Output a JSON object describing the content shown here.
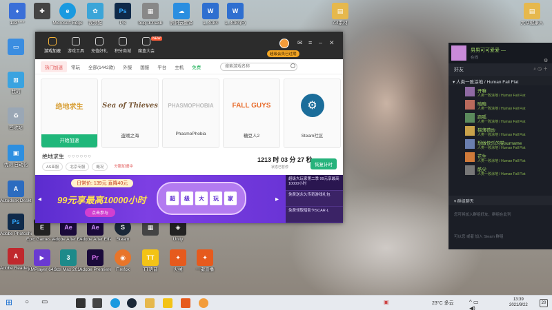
{
  "desktop": {
    "icons": [
      {
        "label": "133****",
        "color": "#3a6fd8"
      },
      {
        "label": "",
        "color": "#444"
      },
      {
        "label": "Microsoft Edge",
        "color": "#1a9ae0"
      },
      {
        "label": "视频配",
        "color": "#3ba5d8"
      },
      {
        "label": "PS",
        "color": "#0f2a4a"
      },
      {
        "label": "renren",
        "color": "#888"
      },
      {
        "label": "bug-d0f/a8b",
        "color": "#777"
      },
      {
        "label": "腾讯云翻译",
        "color": "#2b8ee0"
      },
      {
        "label": "1_4084",
        "color": "#2f6fd0"
      },
      {
        "label": "1_4084(F)",
        "color": "#2f6fd0"
      },
      {
        "label": "A4素材",
        "color": "#e6b84d"
      },
      {
        "label": "大众健康人",
        "color": "#e6b84d"
      }
    ],
    "left_icons": [
      {
        "label": "",
        "color": "#3b8de0"
      },
      {
        "label": "我的",
        "color": "#3aa3e0"
      },
      {
        "label": "回收站",
        "color": "#9aa7b5"
      },
      {
        "label": "优测 自动化",
        "color": "#2e8fe0"
      },
      {
        "label": "Autodesk Desktop",
        "color": "#2c6cc0"
      },
      {
        "label": "Adobe Photoshop",
        "color": "#0f2a4a"
      },
      {
        "label": "Adobe Reader XI",
        "color": "#c0282d"
      }
    ],
    "row_icons": [
      {
        "label": "Epic Games Launcher",
        "color": "#222"
      },
      {
        "label": "Adobe After Effects",
        "color": "#1a0a3a"
      },
      {
        "label": "Adobe After Effects",
        "color": "#1a0a3a"
      },
      {
        "label": "Steam",
        "color": "#1b2838"
      },
      {
        "label": "",
        "color": "#444"
      },
      {
        "label": "Unity",
        "color": "#222"
      },
      {
        "label": "KMPlayer 64X",
        "color": "#6a3ad1"
      },
      {
        "label": "3ds Max 2019",
        "color": "#1d8a8a"
      },
      {
        "label": "Adobe Premiere",
        "color": "#1a0a3a"
      },
      {
        "label": "Firefox",
        "color": "#e8752a"
      },
      {
        "label": "TT语音",
        "color": "#f3c316"
      },
      {
        "label": "火绒",
        "color": "#e65a1d"
      },
      {
        "label": "一键直播",
        "color": "#e65a1d"
      }
    ]
  },
  "booster": {
    "nav": [
      {
        "label": "游戏加速",
        "active": true
      },
      {
        "label": "游戏工具",
        "active": false
      },
      {
        "label": "充值好礼",
        "active": false
      },
      {
        "label": "积分商城",
        "active": false
      },
      {
        "label": "魔盒大会",
        "active": false
      }
    ],
    "new_badge": "NEW",
    "vip_label": "超级会员已过期",
    "tabs": [
      {
        "label": "热门加速",
        "active": true,
        "green": false
      },
      {
        "label": "常玩",
        "active": false,
        "green": false
      },
      {
        "label": "全部(1442款)",
        "active": false,
        "green": false
      },
      {
        "label": "外服",
        "active": false,
        "green": false
      },
      {
        "label": "国服",
        "active": false,
        "green": false
      },
      {
        "label": "平台",
        "active": false,
        "green": false
      },
      {
        "label": "主机",
        "active": false,
        "green": false
      },
      {
        "label": "免费",
        "active": false,
        "green": true
      }
    ],
    "search_placeholder": "搜索游戏名称",
    "games": [
      {
        "name": "开始加速",
        "art": "绝地求生",
        "art_color": "#d9a13a",
        "selected": true
      },
      {
        "name": "盗贼之海",
        "art": "Sea of Thieves",
        "art_color": "#7a5a3a",
        "selected": false
      },
      {
        "name": "PhasmoPhobia",
        "art": "PHASMOPHOBIA",
        "art_color": "#bbbbbb",
        "selected": false
      },
      {
        "name": "糖豆人2",
        "art": "FALL GUYS",
        "art_color": "#e86b2a",
        "selected": false
      },
      {
        "name": "Steam社区",
        "art": "STEAM",
        "art_color": "#1b6d9a",
        "selected": false
      }
    ],
    "current_game": "绝地求生",
    "current_dots": "○○○○○○",
    "chips": [
      "AS亚服",
      "北京专服",
      "概况",
      "分服加速中"
    ],
    "timer": "1213 时 03 分 27 秒",
    "timer_label": "状态已暂停",
    "stop_label": "恢复计时",
    "ad": {
      "price": "日常价: 139元 直降40元",
      "headline": "99元享最高10000小时",
      "button": "点击参与",
      "slot": [
        "超",
        "级",
        "大",
        "玩",
        "家"
      ]
    },
    "side_items": [
      {
        "label": "超级大玩家第二季 99元享最高10000小时",
        "active": true
      },
      {
        "label": "免费送永久传奇游戏礼包",
        "active": false
      },
      {
        "label": "免费领取暗影卡SCAR-L",
        "active": false
      }
    ]
  },
  "steam": {
    "user_name": "男男可可爱爱 —",
    "user_status": "在线",
    "friends_label": "好友",
    "group_label": "人类一败涂地 / Human Fall Flat",
    "friends": [
      {
        "name": "开嘛",
        "game": "人类一败涂地 / Human Fall Flat",
        "color": "#8f6aa3"
      },
      {
        "name": "暗暗",
        "game": "人类一败涂地 / Human Fall Flat",
        "color": "#b96a5c"
      },
      {
        "name": "跑呱",
        "game": "人类一败涂地 / Human Fall Flat",
        "color": "#5b8a5c"
      },
      {
        "name": "猫薄荷炒",
        "game": "人类一败涂地 / Human Fall Flat",
        "color": "#c9a24a"
      },
      {
        "name": "想做快乐的猫surname",
        "game": "人类一败涂地 / Human Fall Flat",
        "color": "#6a7fb0"
      },
      {
        "name": "花生",
        "game": "人类一败涂地 / Human Fall Flat",
        "color": "#d07a3a"
      },
      {
        "name": "酷尖",
        "game": "人类一败涂地 / Human Fall Flat",
        "color": "#777"
      }
    ],
    "chat_label": "▾ 群组聊天",
    "chat_hint1": "您可将加入群组好友、群组在此列",
    "chat_hint2": "可以您 或者 加入 Steam 群组"
  },
  "taskbar": {
    "weather": "23°C 多云",
    "time": "13:39",
    "date": "2021/9/22",
    "notify": "20"
  }
}
